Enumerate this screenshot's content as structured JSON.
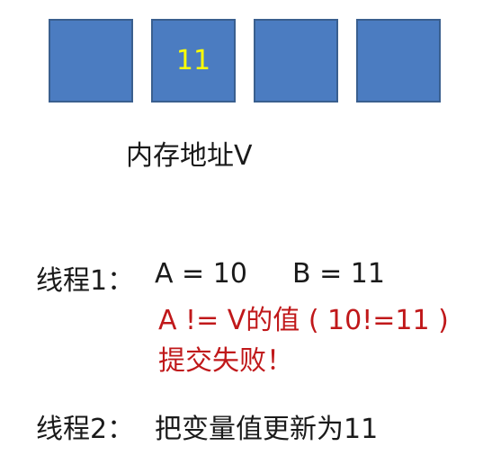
{
  "memory": {
    "cells": [
      "",
      "11",
      "",
      ""
    ],
    "label": "内存地址V"
  },
  "thread1": {
    "label": "线程1：",
    "a": "A = 10",
    "b": "B = 11",
    "compare": "A != V的值 ( 10!=11 )",
    "result": "提交失败！"
  },
  "thread2": {
    "label": "线程2：",
    "action": "把变量值更新为11"
  },
  "colors": {
    "cell_fill": "#4b7cc1",
    "cell_border": "#3a5f8f",
    "cell_text": "#ffff00",
    "alert_text": "#c0181a"
  }
}
